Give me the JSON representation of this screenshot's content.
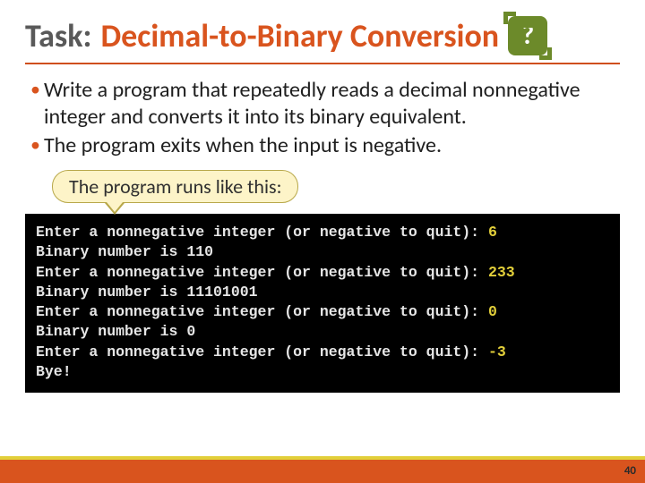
{
  "title": {
    "label": "Task:",
    "text": "Decimal-to-Binary Conversion",
    "badge": "?"
  },
  "bullets": [
    "Write a program that repeatedly reads a decimal nonnegative integer and converts it into its binary equivalent.",
    "The program exits when the input is negative."
  ],
  "callout": "The program runs like this:",
  "terminal": {
    "prompt": "Enter a nonnegative integer (or negative to quit): ",
    "result_prefix": "Binary number is ",
    "runs": [
      {
        "input": "6",
        "output": "110"
      },
      {
        "input": "233",
        "output": "11101001"
      },
      {
        "input": "0",
        "output": "0"
      },
      {
        "input": "-3",
        "output": null
      }
    ],
    "exit_msg": "Bye!"
  },
  "page_number": "40"
}
